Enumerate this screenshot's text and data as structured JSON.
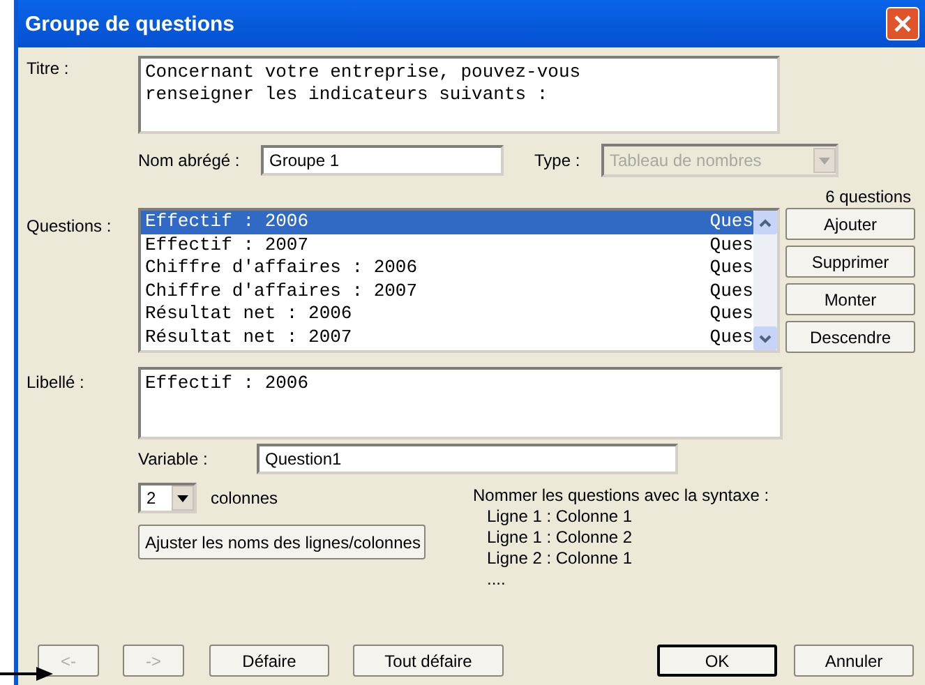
{
  "window": {
    "title": "Groupe de questions"
  },
  "titre": {
    "label": "Titre :",
    "value": "Concernant votre entreprise, pouvez-vous\nrenseigner les indicateurs suivants :"
  },
  "nom_abrege": {
    "label": "Nom abrégé :",
    "value": "Groupe 1"
  },
  "type": {
    "label": "Type :",
    "value": "Tableau de nombres",
    "disabled": true
  },
  "questions": {
    "label": "Questions :",
    "count": "6 questions",
    "rows": [
      {
        "name": "Effectif : 2006",
        "column_2": "Ques",
        "selected": true
      },
      {
        "name": "Effectif : 2007",
        "column_2": "Ques",
        "selected": false
      },
      {
        "name": "Chiffre d'affaires : 2006",
        "column_2": "Ques",
        "selected": false
      },
      {
        "name": "Chiffre d'affaires : 2007",
        "column_2": "Ques",
        "selected": false
      },
      {
        "name": "Résultat net : 2006",
        "column_2": "Ques",
        "selected": false
      },
      {
        "name": "Résultat net : 2007",
        "column_2": "Ques",
        "selected": false
      }
    ]
  },
  "side_buttons": [
    "Ajouter",
    "Supprimer",
    "Monter",
    "Descendre"
  ],
  "libelle": {
    "label": "Libellé :",
    "value": "Effectif : 2006"
  },
  "variable": {
    "label": "Variable :",
    "value": "Question1"
  },
  "colonnes": {
    "value": "2",
    "label": "colonnes"
  },
  "adjust_button": "Ajuster les noms des lignes/colonnes",
  "syntax": {
    "heading": "Nommer les questions avec la syntaxe :",
    "lines": [
      "Ligne 1 : Colonne 1",
      "Ligne 1 : Colonne 2",
      "Ligne 2 : Colonne 1",
      "...."
    ]
  },
  "bottom_buttons": [
    {
      "label": "<-",
      "disabled": true,
      "default": false
    },
    {
      "label": "->",
      "disabled": true,
      "default": false
    },
    {
      "label": "Défaire",
      "disabled": false,
      "default": false
    },
    {
      "label": "Tout défaire",
      "disabled": false,
      "default": false
    },
    {
      "label": "OK",
      "disabled": false,
      "default": true
    },
    {
      "label": "Annuler",
      "disabled": false,
      "default": false
    }
  ]
}
